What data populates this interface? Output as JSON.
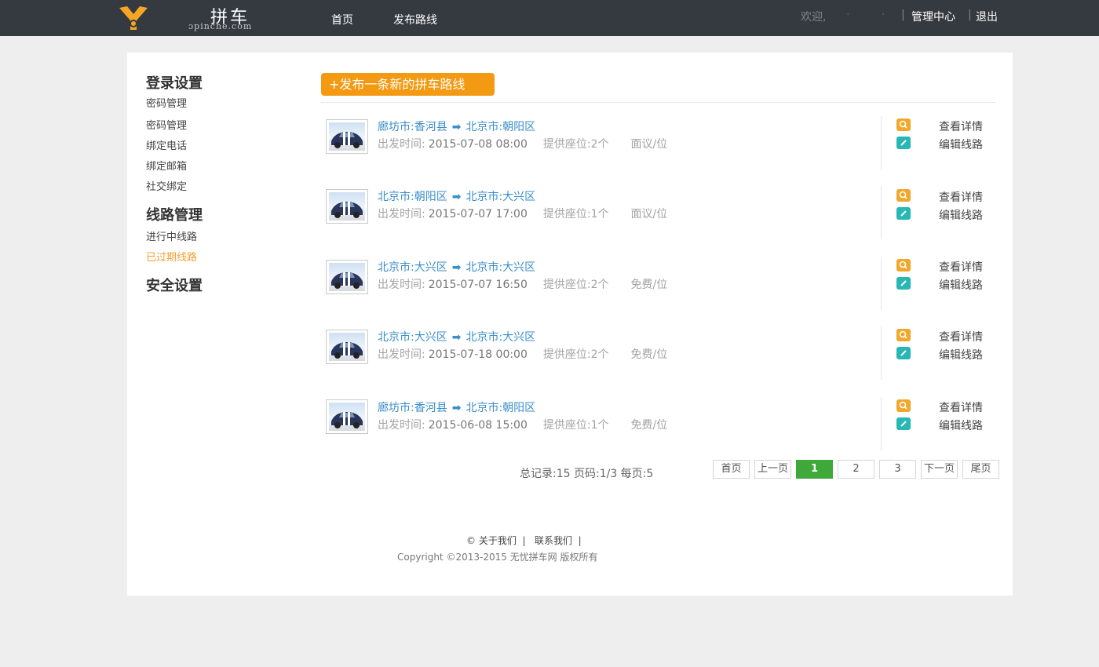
{
  "header": {
    "logo_title": "拼车",
    "logo_domain": "ɔpinche.com",
    "nav": {
      "home": "首页",
      "publish": "发布路线"
    },
    "welcome": "欢迎,",
    "user_masked": "· · ·",
    "separator": "|",
    "admin_center": "管理中心",
    "logout": "退出"
  },
  "sidebar": {
    "groups": [
      {
        "title": "登录设置",
        "items": [
          "密码管理",
          "密码管理",
          "绑定电话",
          "绑定邮箱",
          "社交绑定"
        ]
      },
      {
        "title": "线路管理",
        "items": [
          "进行中线路",
          "已过期线路"
        ],
        "active_index": 1
      },
      {
        "title": "安全设置",
        "items": []
      }
    ]
  },
  "main": {
    "publish_button": "+发布一条新的拼车路线",
    "meta_labels": {
      "depart": "出发时间:",
      "seats_prefix": "提供座位:"
    },
    "actions": {
      "view": "查看详情",
      "edit": "编辑线路"
    },
    "routes": [
      {
        "from": "廊坊市:香河县",
        "arrow": "➡",
        "to": "北京市:朝阳区",
        "time": "2015-07-08 08:00",
        "seats": "提供座位:2个",
        "price": "面议/位"
      },
      {
        "from": "北京市:朝阳区",
        "arrow": "➡",
        "to": "北京市:大兴区",
        "time": "2015-07-07 17:00",
        "seats": "提供座位:1个",
        "price": "面议/位"
      },
      {
        "from": "北京市:大兴区",
        "arrow": "➡",
        "to": "北京市:大兴区",
        "time": "2015-07-07 16:50",
        "seats": "提供座位:2个",
        "price": "免费/位"
      },
      {
        "from": "北京市:大兴区",
        "arrow": "➡",
        "to": "北京市:大兴区",
        "time": "2015-07-18 00:00",
        "seats": "提供座位:2个",
        "price": "免费/位"
      },
      {
        "from": "廊坊市:香河县",
        "arrow": "➡",
        "to": "北京市:朝阳区",
        "time": "2015-06-08 15:00",
        "seats": "提供座位:1个",
        "price": "免费/位"
      }
    ]
  },
  "pagination": {
    "summary": "总记录:15 页码:1/3 每页:5",
    "first": "首页",
    "prev": "上一页",
    "pages": [
      "1",
      "2",
      "3"
    ],
    "current": "1",
    "next": "下一页",
    "last": "尾页"
  },
  "footer": {
    "copyright_symbol": "©",
    "about": "关于我们",
    "contact": "联系我们",
    "separator": "|",
    "copyright": "Copyright ©2013-2015 无忧拼车网 版权所有"
  },
  "colors": {
    "topbar": "#353a40",
    "accent_orange": "#f39a12",
    "link_blue": "#3a8ec9",
    "page_active_green": "#3ea83b",
    "edit_icon_teal": "#27b7b5",
    "sidebar_active": "#f0a030"
  },
  "icons": {
    "logo": "logo-mark-icon",
    "view": "search-icon",
    "edit": "pencil-icon",
    "thumb": "car-icon"
  }
}
